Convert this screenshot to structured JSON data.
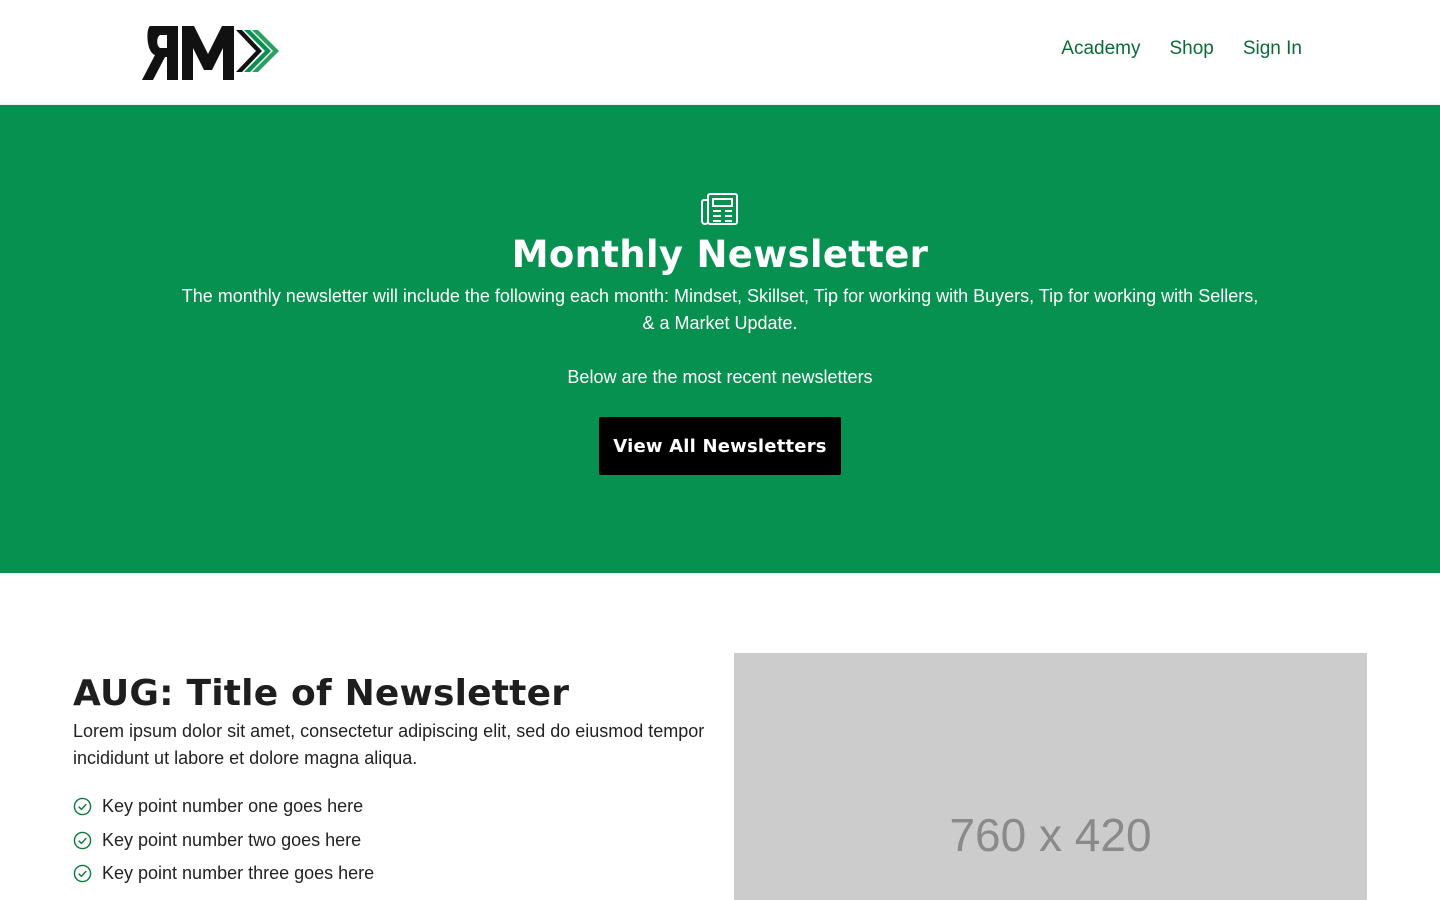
{
  "nav": {
    "items": [
      {
        "label": "Academy"
      },
      {
        "label": "Shop"
      },
      {
        "label": "Sign In"
      }
    ]
  },
  "brand": {
    "logo_text": "RM",
    "accent_color": "#079150",
    "link_color": "#0b6b37"
  },
  "hero": {
    "icon": "newspaper-icon",
    "title": "Monthly Newsletter",
    "description": "The monthly newsletter will include the following each month: Mindset, Skillset, Tip for working with Buyers, Tip for working with Sellers, & a Market Update.",
    "subtitle": "Below are the most recent newsletters",
    "button_label": "View All Newsletters"
  },
  "newsletter": {
    "title": "AUG: Title of Newsletter",
    "description": "Lorem ipsum dolor sit amet, consectetur adipiscing elit, sed do eiusmod tempor incididunt ut labore et dolore magna aliqua.",
    "key_points": [
      "Key point number one goes here",
      "Key point number two goes here",
      "Key point number three goes here"
    ],
    "image_placeholder": "760 x 420"
  }
}
